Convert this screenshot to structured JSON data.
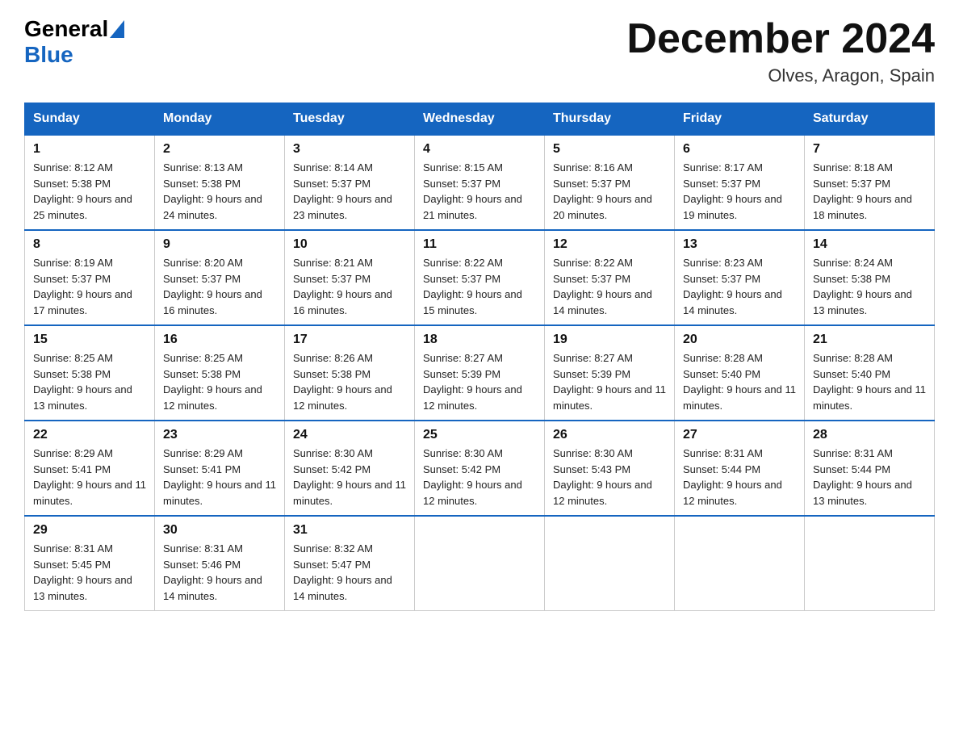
{
  "header": {
    "logo_general": "General",
    "logo_blue": "Blue",
    "month_title": "December 2024",
    "location": "Olves, Aragon, Spain"
  },
  "days_of_week": [
    "Sunday",
    "Monday",
    "Tuesday",
    "Wednesday",
    "Thursday",
    "Friday",
    "Saturday"
  ],
  "weeks": [
    [
      {
        "date": "1",
        "sunrise": "Sunrise: 8:12 AM",
        "sunset": "Sunset: 5:38 PM",
        "daylight": "Daylight: 9 hours and 25 minutes."
      },
      {
        "date": "2",
        "sunrise": "Sunrise: 8:13 AM",
        "sunset": "Sunset: 5:38 PM",
        "daylight": "Daylight: 9 hours and 24 minutes."
      },
      {
        "date": "3",
        "sunrise": "Sunrise: 8:14 AM",
        "sunset": "Sunset: 5:37 PM",
        "daylight": "Daylight: 9 hours and 23 minutes."
      },
      {
        "date": "4",
        "sunrise": "Sunrise: 8:15 AM",
        "sunset": "Sunset: 5:37 PM",
        "daylight": "Daylight: 9 hours and 21 minutes."
      },
      {
        "date": "5",
        "sunrise": "Sunrise: 8:16 AM",
        "sunset": "Sunset: 5:37 PM",
        "daylight": "Daylight: 9 hours and 20 minutes."
      },
      {
        "date": "6",
        "sunrise": "Sunrise: 8:17 AM",
        "sunset": "Sunset: 5:37 PM",
        "daylight": "Daylight: 9 hours and 19 minutes."
      },
      {
        "date": "7",
        "sunrise": "Sunrise: 8:18 AM",
        "sunset": "Sunset: 5:37 PM",
        "daylight": "Daylight: 9 hours and 18 minutes."
      }
    ],
    [
      {
        "date": "8",
        "sunrise": "Sunrise: 8:19 AM",
        "sunset": "Sunset: 5:37 PM",
        "daylight": "Daylight: 9 hours and 17 minutes."
      },
      {
        "date": "9",
        "sunrise": "Sunrise: 8:20 AM",
        "sunset": "Sunset: 5:37 PM",
        "daylight": "Daylight: 9 hours and 16 minutes."
      },
      {
        "date": "10",
        "sunrise": "Sunrise: 8:21 AM",
        "sunset": "Sunset: 5:37 PM",
        "daylight": "Daylight: 9 hours and 16 minutes."
      },
      {
        "date": "11",
        "sunrise": "Sunrise: 8:22 AM",
        "sunset": "Sunset: 5:37 PM",
        "daylight": "Daylight: 9 hours and 15 minutes."
      },
      {
        "date": "12",
        "sunrise": "Sunrise: 8:22 AM",
        "sunset": "Sunset: 5:37 PM",
        "daylight": "Daylight: 9 hours and 14 minutes."
      },
      {
        "date": "13",
        "sunrise": "Sunrise: 8:23 AM",
        "sunset": "Sunset: 5:37 PM",
        "daylight": "Daylight: 9 hours and 14 minutes."
      },
      {
        "date": "14",
        "sunrise": "Sunrise: 8:24 AM",
        "sunset": "Sunset: 5:38 PM",
        "daylight": "Daylight: 9 hours and 13 minutes."
      }
    ],
    [
      {
        "date": "15",
        "sunrise": "Sunrise: 8:25 AM",
        "sunset": "Sunset: 5:38 PM",
        "daylight": "Daylight: 9 hours and 13 minutes."
      },
      {
        "date": "16",
        "sunrise": "Sunrise: 8:25 AM",
        "sunset": "Sunset: 5:38 PM",
        "daylight": "Daylight: 9 hours and 12 minutes."
      },
      {
        "date": "17",
        "sunrise": "Sunrise: 8:26 AM",
        "sunset": "Sunset: 5:38 PM",
        "daylight": "Daylight: 9 hours and 12 minutes."
      },
      {
        "date": "18",
        "sunrise": "Sunrise: 8:27 AM",
        "sunset": "Sunset: 5:39 PM",
        "daylight": "Daylight: 9 hours and 12 minutes."
      },
      {
        "date": "19",
        "sunrise": "Sunrise: 8:27 AM",
        "sunset": "Sunset: 5:39 PM",
        "daylight": "Daylight: 9 hours and 11 minutes."
      },
      {
        "date": "20",
        "sunrise": "Sunrise: 8:28 AM",
        "sunset": "Sunset: 5:40 PM",
        "daylight": "Daylight: 9 hours and 11 minutes."
      },
      {
        "date": "21",
        "sunrise": "Sunrise: 8:28 AM",
        "sunset": "Sunset: 5:40 PM",
        "daylight": "Daylight: 9 hours and 11 minutes."
      }
    ],
    [
      {
        "date": "22",
        "sunrise": "Sunrise: 8:29 AM",
        "sunset": "Sunset: 5:41 PM",
        "daylight": "Daylight: 9 hours and 11 minutes."
      },
      {
        "date": "23",
        "sunrise": "Sunrise: 8:29 AM",
        "sunset": "Sunset: 5:41 PM",
        "daylight": "Daylight: 9 hours and 11 minutes."
      },
      {
        "date": "24",
        "sunrise": "Sunrise: 8:30 AM",
        "sunset": "Sunset: 5:42 PM",
        "daylight": "Daylight: 9 hours and 11 minutes."
      },
      {
        "date": "25",
        "sunrise": "Sunrise: 8:30 AM",
        "sunset": "Sunset: 5:42 PM",
        "daylight": "Daylight: 9 hours and 12 minutes."
      },
      {
        "date": "26",
        "sunrise": "Sunrise: 8:30 AM",
        "sunset": "Sunset: 5:43 PM",
        "daylight": "Daylight: 9 hours and 12 minutes."
      },
      {
        "date": "27",
        "sunrise": "Sunrise: 8:31 AM",
        "sunset": "Sunset: 5:44 PM",
        "daylight": "Daylight: 9 hours and 12 minutes."
      },
      {
        "date": "28",
        "sunrise": "Sunrise: 8:31 AM",
        "sunset": "Sunset: 5:44 PM",
        "daylight": "Daylight: 9 hours and 13 minutes."
      }
    ],
    [
      {
        "date": "29",
        "sunrise": "Sunrise: 8:31 AM",
        "sunset": "Sunset: 5:45 PM",
        "daylight": "Daylight: 9 hours and 13 minutes."
      },
      {
        "date": "30",
        "sunrise": "Sunrise: 8:31 AM",
        "sunset": "Sunset: 5:46 PM",
        "daylight": "Daylight: 9 hours and 14 minutes."
      },
      {
        "date": "31",
        "sunrise": "Sunrise: 8:32 AM",
        "sunset": "Sunset: 5:47 PM",
        "daylight": "Daylight: 9 hours and 14 minutes."
      },
      null,
      null,
      null,
      null
    ]
  ]
}
